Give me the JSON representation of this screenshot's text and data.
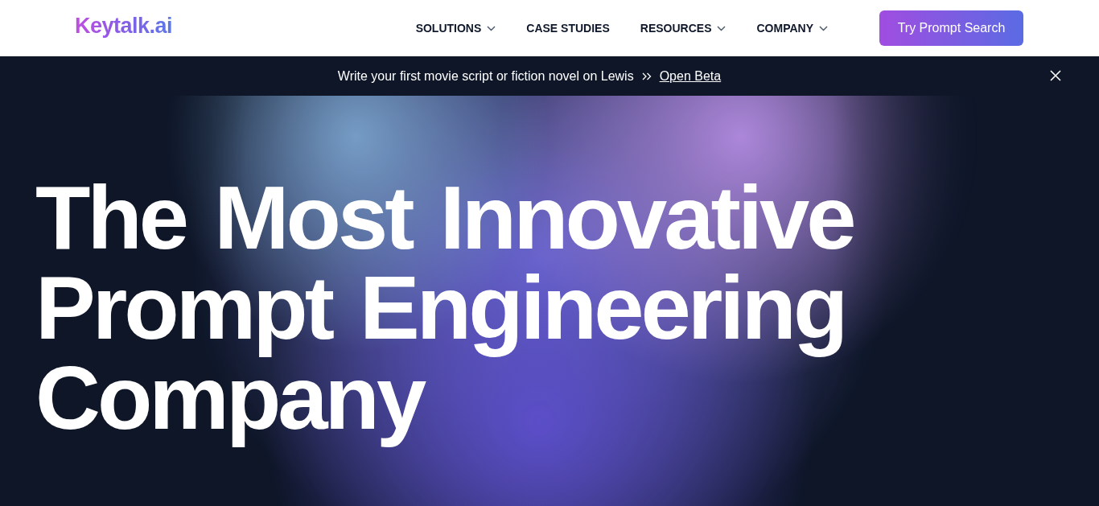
{
  "header": {
    "logo": "Keytalk.ai",
    "nav": [
      {
        "label": "SOLUTIONS",
        "kind": "dropdown"
      },
      {
        "label": "CASE STUDIES",
        "kind": "link"
      },
      {
        "label": "RESOURCES",
        "kind": "dropdown"
      },
      {
        "label": "COMPANY",
        "kind": "dropdown"
      }
    ],
    "cta": "Try Prompt Search"
  },
  "banner": {
    "text": "Write your first movie script or fiction novel on Lewis",
    "link": "Open Beta"
  },
  "hero": {
    "title_lines": [
      "The Most Innovative",
      "Prompt Engineering",
      "Company"
    ]
  }
}
